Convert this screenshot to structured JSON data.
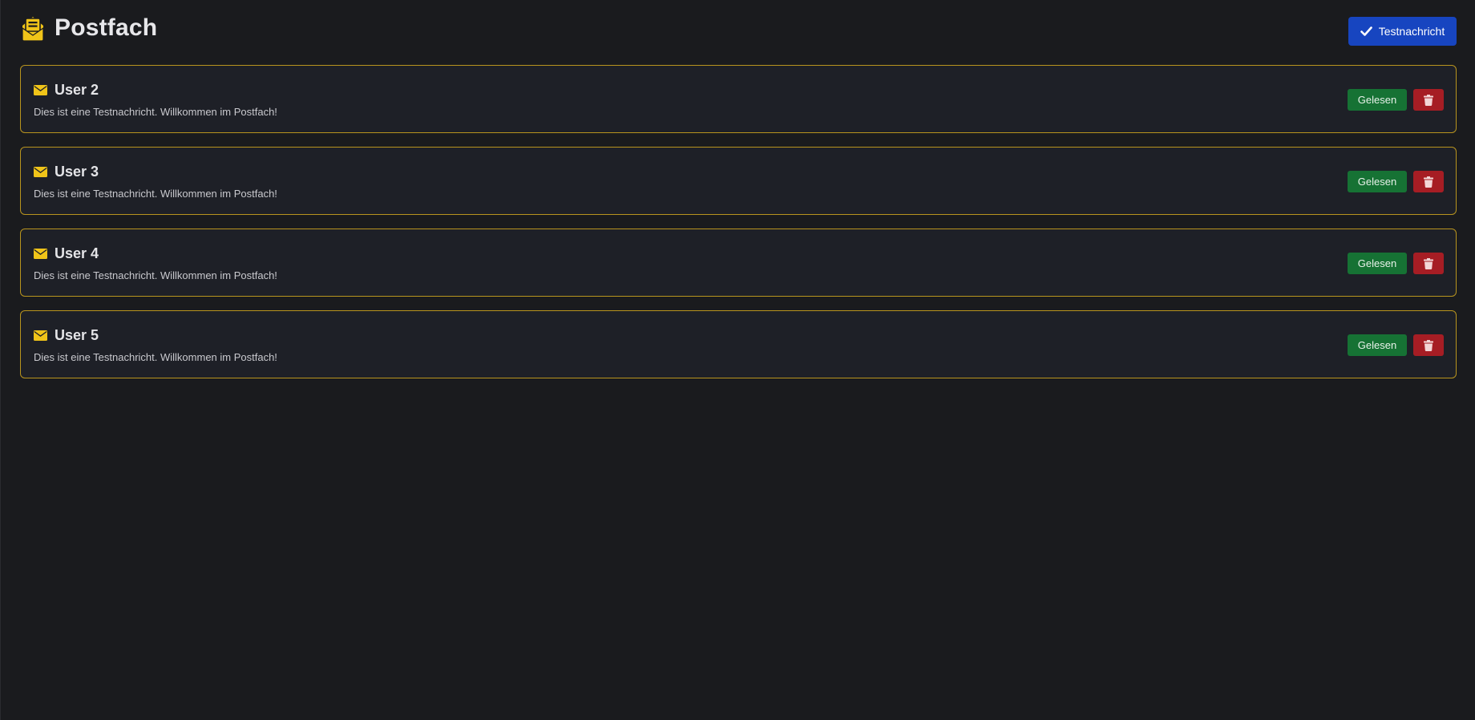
{
  "header": {
    "title": "Postfach",
    "title_icon": "envelope-open-text-icon",
    "test_button_label": "Testnachricht",
    "test_button_icon": "check-icon"
  },
  "colors": {
    "background": "#1a1b1e",
    "card_background": "#1e2027",
    "card_border": "#b8941e",
    "accent_yellow": "#f0c419",
    "primary_blue": "#1745c0",
    "success_green": "#167234",
    "danger_red": "#a61d24"
  },
  "messages": [
    {
      "sender": "User 2",
      "text": "Dies ist eine Testnachricht. Willkommen im Postfach!",
      "icon": "envelope-icon",
      "read_label": "Gelesen",
      "delete_icon": "trash-icon"
    },
    {
      "sender": "User 3",
      "text": "Dies ist eine Testnachricht. Willkommen im Postfach!",
      "icon": "envelope-icon",
      "read_label": "Gelesen",
      "delete_icon": "trash-icon"
    },
    {
      "sender": "User 4",
      "text": "Dies ist eine Testnachricht. Willkommen im Postfach!",
      "icon": "envelope-icon",
      "read_label": "Gelesen",
      "delete_icon": "trash-icon"
    },
    {
      "sender": "User 5",
      "text": "Dies ist eine Testnachricht. Willkommen im Postfach!",
      "icon": "envelope-icon",
      "read_label": "Gelesen",
      "delete_icon": "trash-icon"
    }
  ]
}
